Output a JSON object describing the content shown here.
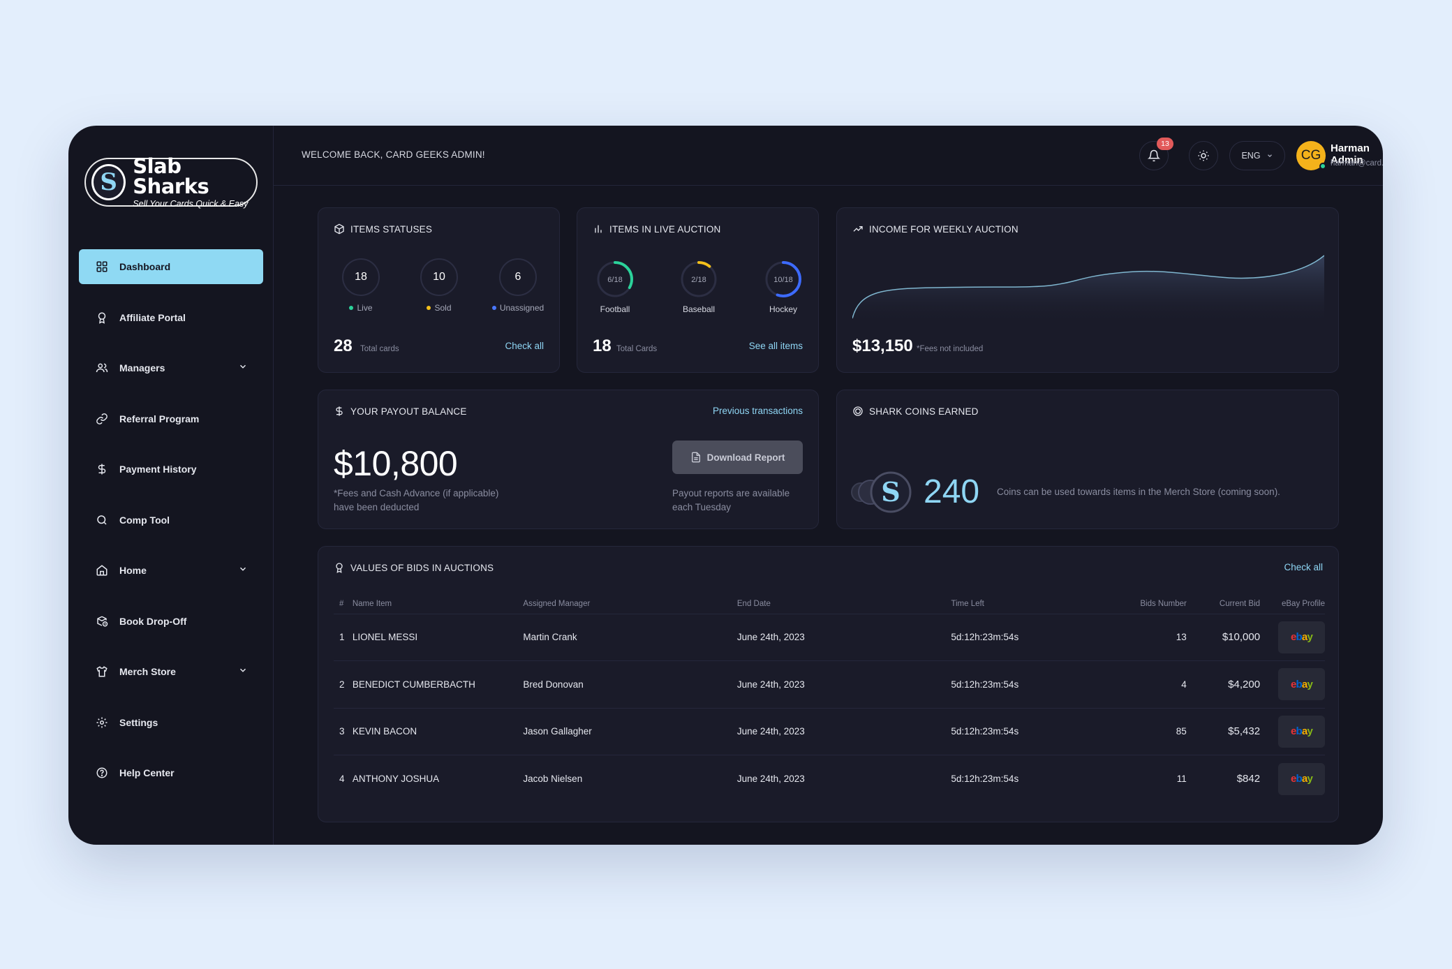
{
  "brand": {
    "title": "Slab Sharks",
    "tagline": "Sell Your Cards Quick & Easy",
    "mark": "S"
  },
  "sidebar": {
    "items": [
      {
        "label": "Dashboard",
        "icon": "grid-icon",
        "active": true
      },
      {
        "label": "Affiliate Portal",
        "icon": "award-icon"
      },
      {
        "label": "Managers",
        "icon": "users-icon",
        "expandable": true
      },
      {
        "label": "Referral Program",
        "icon": "link-icon"
      },
      {
        "label": "Payment History",
        "icon": "dollar-icon"
      },
      {
        "label": "Comp Tool",
        "icon": "search-icon"
      },
      {
        "label": "Home",
        "icon": "home-icon",
        "expandable": true
      },
      {
        "label": "Book Drop-Off",
        "icon": "box-clock-icon"
      },
      {
        "label": "Merch Store",
        "icon": "tshirt-icon",
        "expandable": true
      },
      {
        "label": "Settings",
        "icon": "gear-icon"
      },
      {
        "label": "Help Center",
        "icon": "help-icon"
      }
    ]
  },
  "header": {
    "welcome": "WELCOME BACK, CARD GEEKS ADMIN!",
    "notifications": "13",
    "language": "ENG",
    "user": {
      "initials": "CG",
      "name": "Harman Admin",
      "email": "harman@card.geeks"
    }
  },
  "item_statuses": {
    "title": "ITEMS STATUSES",
    "stats": [
      {
        "value": "18",
        "label": "Live",
        "color": "#2bd29a"
      },
      {
        "value": "10",
        "label": "Sold",
        "color": "#f4c01b"
      },
      {
        "value": "6",
        "label": "Unassigned",
        "color": "#4a78ff"
      }
    ],
    "total": "28",
    "total_label": "Total cards",
    "link": "Check all"
  },
  "live_auction": {
    "title": "ITEMS IN LIVE AUCTION",
    "rings": [
      {
        "text": "6/18",
        "fraction": 0.333,
        "label": "Football",
        "color": "#2bd29a"
      },
      {
        "text": "2/18",
        "fraction": 0.111,
        "label": "Baseball",
        "color": "#f4c01b"
      },
      {
        "text": "10/18",
        "fraction": 0.556,
        "label": "Hockey",
        "color": "#3d6bff"
      }
    ],
    "total": "18",
    "total_label": "Total Cards",
    "link": "See all items"
  },
  "income": {
    "title": "INCOME FOR WEEKLY AUCTION",
    "amount": "$13,150",
    "note": "*Fees not included"
  },
  "payout": {
    "title": "YOUR PAYOUT BALANCE",
    "link": "Previous transactions",
    "amount": "$10,800",
    "note_line1": "*Fees and Cash Advance (if applicable)",
    "note_line2": "have been deducted",
    "button": "Download Report",
    "report_line1": "Payout reports are available",
    "report_line2": "each Tuesday"
  },
  "coins": {
    "title": "SHARK COINS EARNED",
    "value": "240",
    "text": "Coins can be used towards items in the Merch Store (coming soon)."
  },
  "bids": {
    "title": "VALUES OF BIDS IN AUCTIONS",
    "link": "Check all",
    "columns": [
      "#",
      "Name Item",
      "Assigned Manager",
      "End Date",
      "Time Left",
      "Bids Number",
      "Current Bid",
      "eBay Profile"
    ],
    "rows": [
      {
        "idx": "1",
        "name": "LIONEL MESSI",
        "manager": "Martin Crank",
        "end": "June 24th, 2023",
        "left": "5d:12h:23m:54s",
        "bids": "13",
        "current": "$10,000"
      },
      {
        "idx": "2",
        "name": "BENEDICT CUMBERBACTH",
        "manager": "Bred Donovan",
        "end": "June 24th, 2023",
        "left": "5d:12h:23m:54s",
        "bids": "4",
        "current": "$4,200"
      },
      {
        "idx": "3",
        "name": "KEVIN BACON",
        "manager": "Jason Gallagher",
        "end": "June 24th, 2023",
        "left": "5d:12h:23m:54s",
        "bids": "85",
        "current": "$5,432"
      },
      {
        "idx": "4",
        "name": "ANTHONY JOSHUA",
        "manager": "Jacob Nielsen",
        "end": "June 24th, 2023",
        "left": "5d:12h:23m:54s",
        "bids": "11",
        "current": "$842"
      }
    ]
  }
}
